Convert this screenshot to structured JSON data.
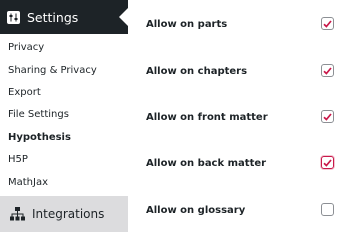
{
  "sidebar": {
    "header": {
      "label": "Settings",
      "icon": "gear-icon"
    },
    "items": [
      {
        "label": "Privacy"
      },
      {
        "label": "Sharing & Privacy"
      },
      {
        "label": "Export"
      },
      {
        "label": "File Settings"
      },
      {
        "label": "Hypothesis",
        "current": true
      },
      {
        "label": "H5P"
      },
      {
        "label": "MathJax"
      }
    ],
    "integrations": {
      "label": "Integrations",
      "icon": "sitemap-icon"
    }
  },
  "settings": {
    "rows": [
      {
        "label": "Allow on parts",
        "checked": true
      },
      {
        "label": "Allow on chapters",
        "checked": true
      },
      {
        "label": "Allow on front matter",
        "checked": true
      },
      {
        "label": "Allow on back matter",
        "checked": true,
        "focused": true
      },
      {
        "label": "Allow on glossary",
        "checked": false
      }
    ]
  },
  "colors": {
    "sidebar_dark": "#1d2327",
    "check_red": "#c9184a",
    "sidebar_bg": "#f0f0f1"
  }
}
